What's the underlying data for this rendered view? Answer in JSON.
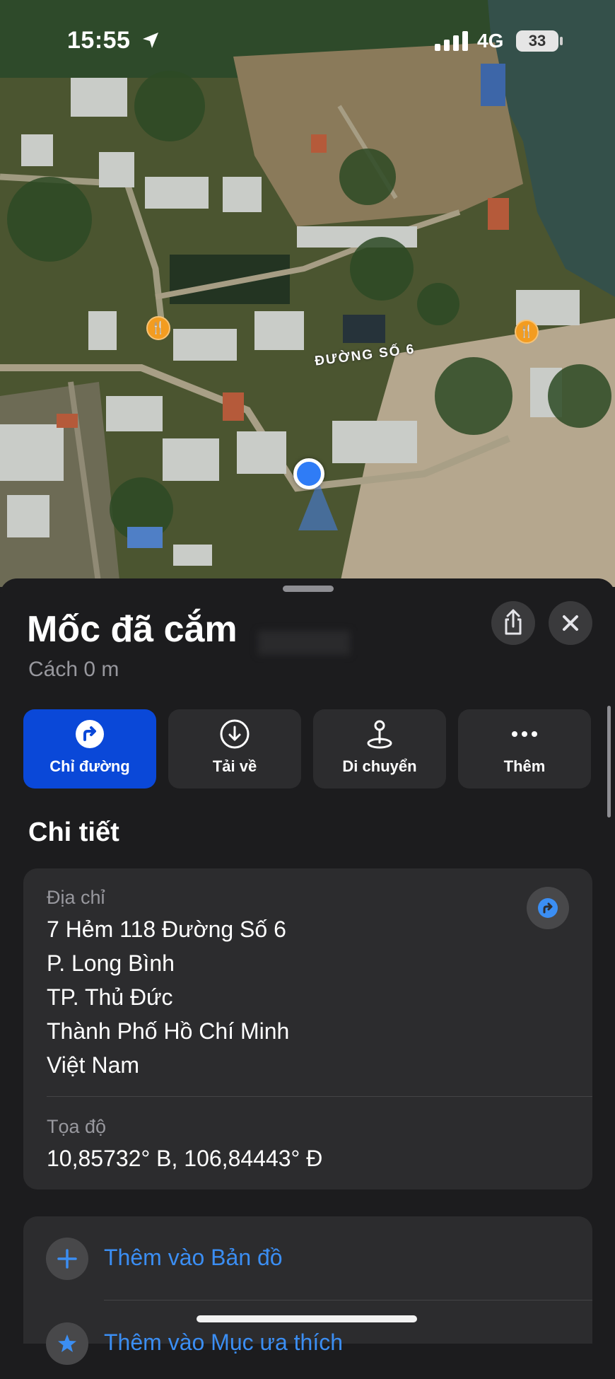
{
  "status_bar": {
    "time": "15:55",
    "network": "4G",
    "battery": "33"
  },
  "map": {
    "road_label": "ĐƯỜNG SỐ 6",
    "poi_icons": [
      "restaurant-icon",
      "restaurant-icon"
    ]
  },
  "place": {
    "title": "Mốc đã cắm",
    "subtitle": "Cách 0 m"
  },
  "actions": [
    {
      "label": "Chỉ đường",
      "icon": "directions-icon"
    },
    {
      "label": "Tải về",
      "icon": "download-icon"
    },
    {
      "label": "Di chuyển",
      "icon": "move-pin-icon"
    },
    {
      "label": "Thêm",
      "icon": "more-icon"
    }
  ],
  "details": {
    "section_title": "Chi tiết",
    "address_label": "Địa chỉ",
    "address_lines": [
      "7 Hẻm 118 Đường Số 6",
      "P. Long Bình",
      "TP. Thủ Đức",
      "Thành Phố Hồ Chí Minh",
      "Việt Nam"
    ],
    "coords_label": "Tọa độ",
    "coords_value": "10,85732° B, 106,84443° Đ"
  },
  "list": {
    "add_to_map": "Thêm vào Bản đồ",
    "add_to_favorites": "Thêm vào Mục ưa thích"
  },
  "colors": {
    "primary_button": "#0a48d8",
    "link_blue": "#3b8ef3",
    "sheet_bg": "#1c1c1e",
    "card_bg": "#2c2c2e"
  }
}
